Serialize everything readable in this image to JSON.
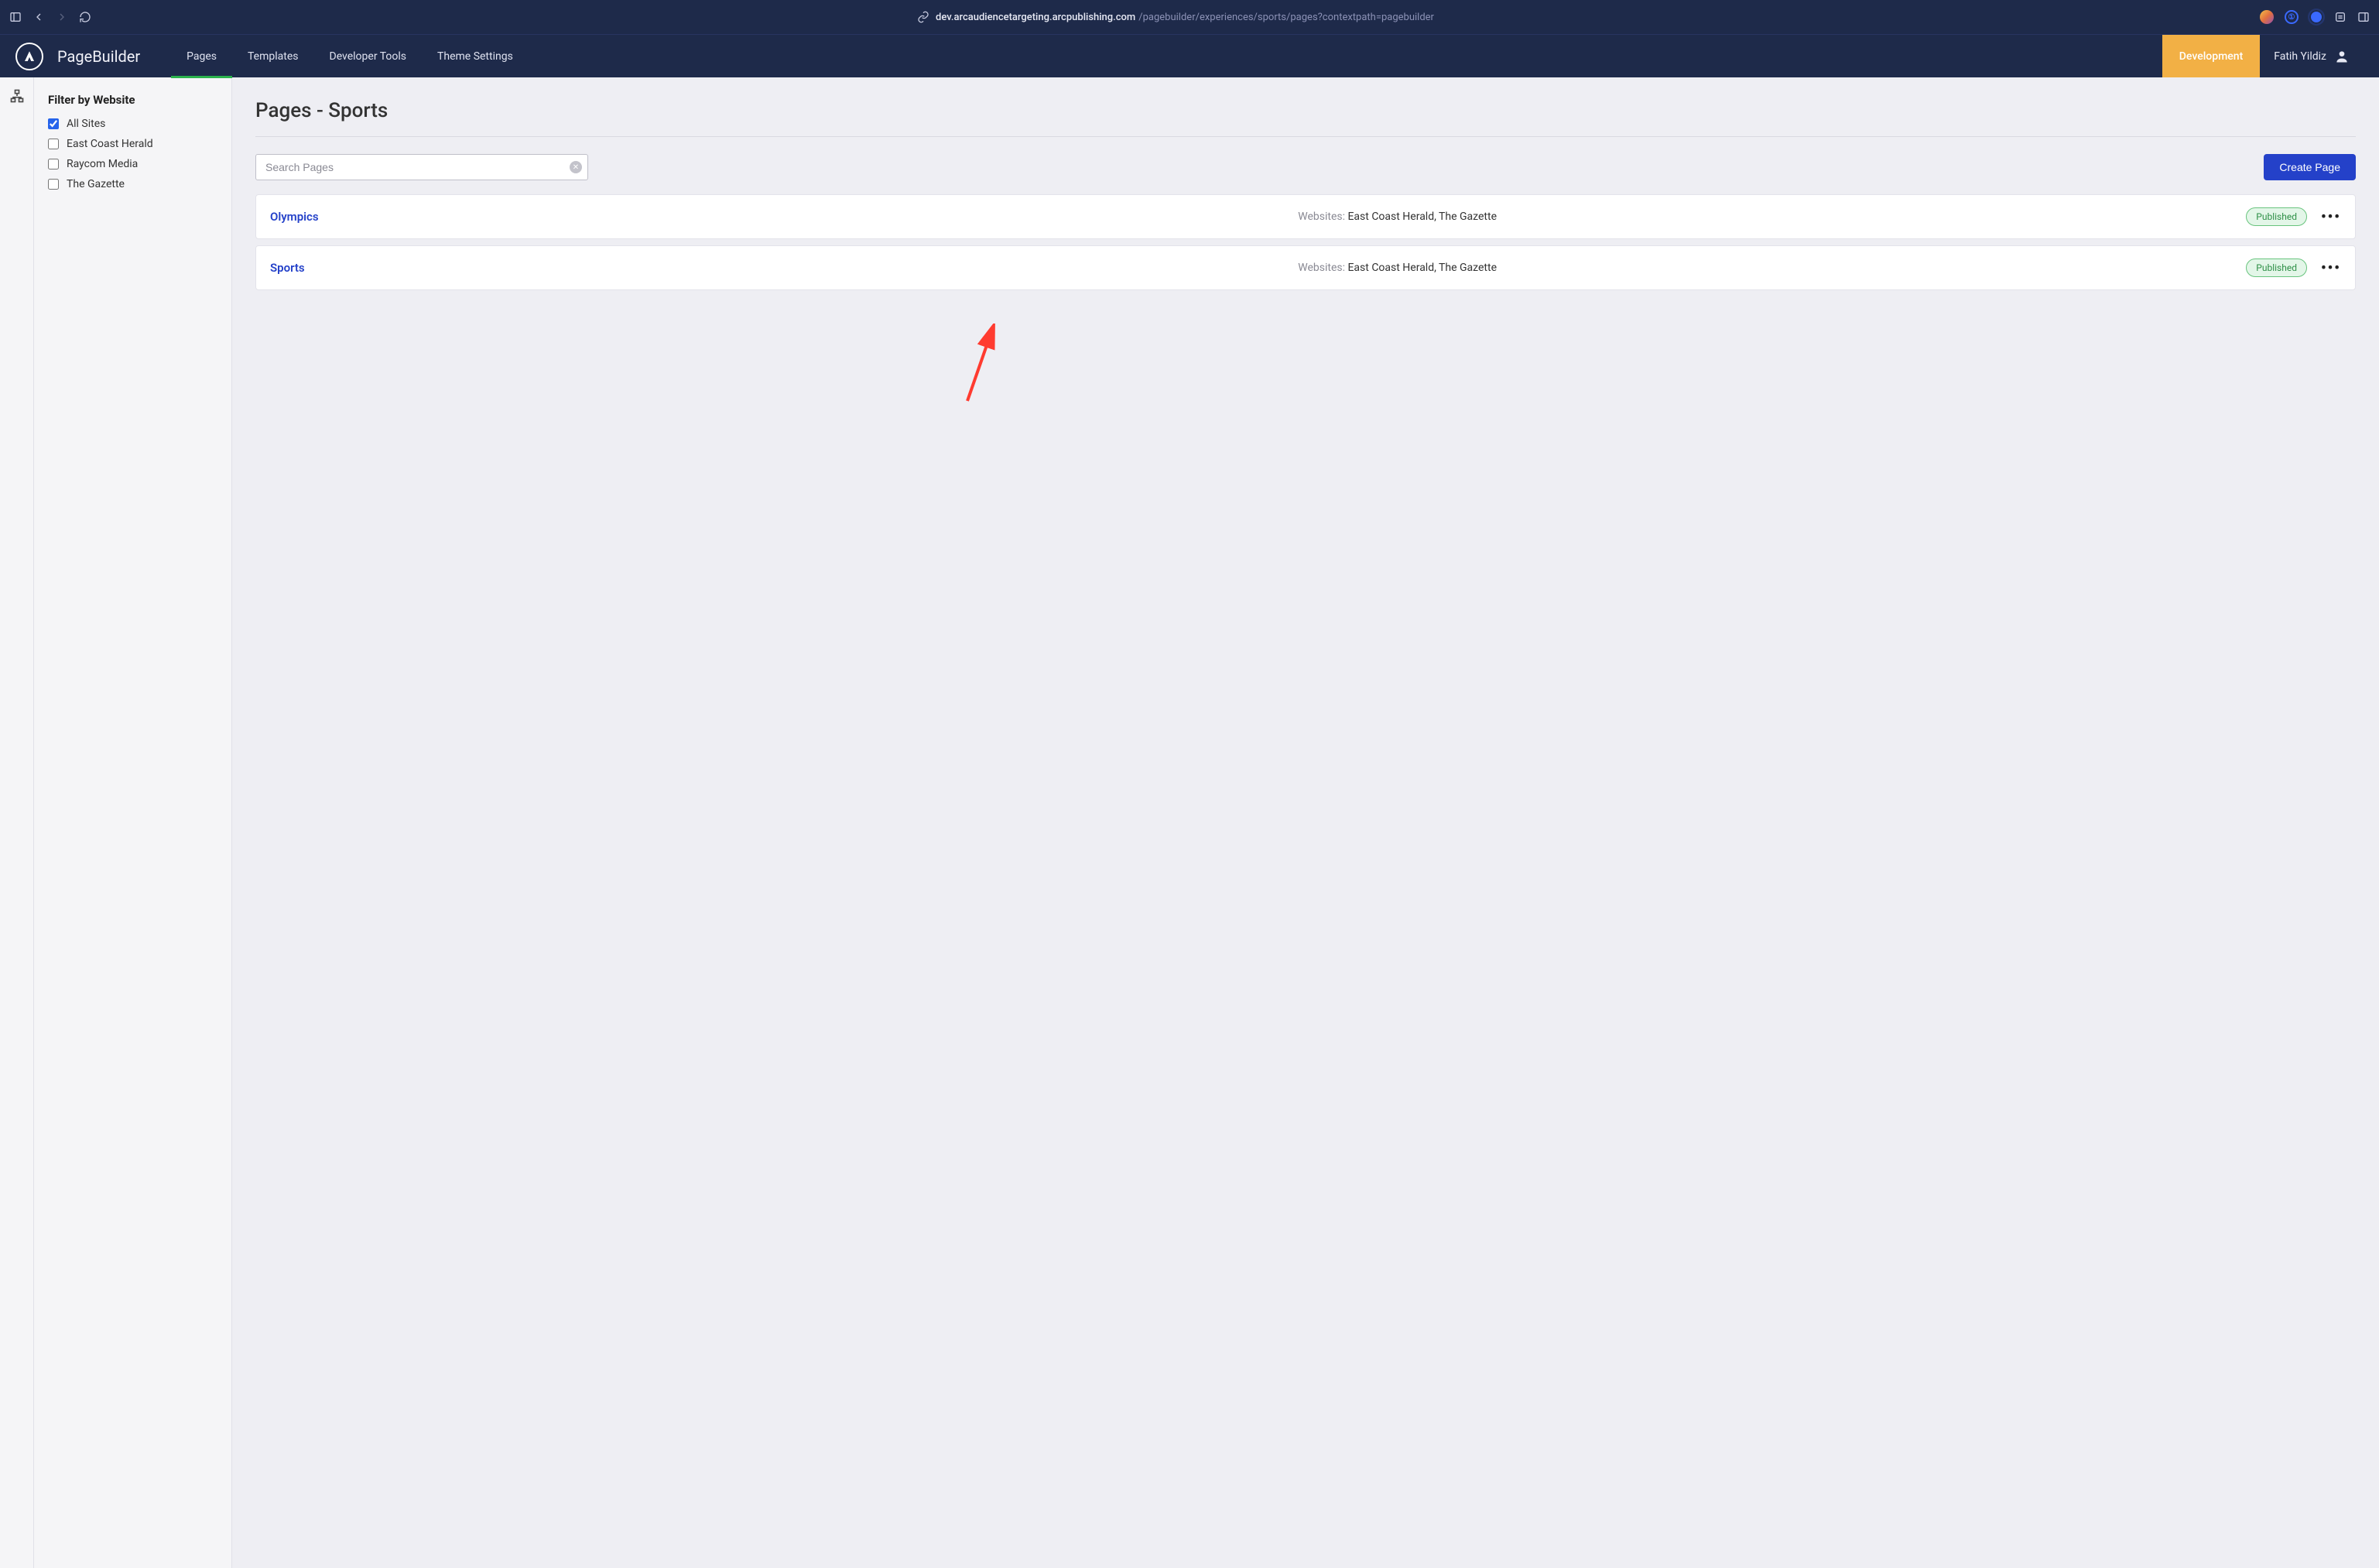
{
  "browser": {
    "url_host": "dev.arcaudiencetargeting.arcpublishing.com",
    "url_path": "/pagebuilder/experiences/sports/pages?contextpath=pagebuilder"
  },
  "header": {
    "brand": "PageBuilder",
    "nav": {
      "pages": "Pages",
      "templates": "Templates",
      "devtools": "Developer Tools",
      "theme": "Theme Settings"
    },
    "env": "Development",
    "user": "Fatih Yildiz"
  },
  "sidebar": {
    "title": "Filter by Website",
    "filters": {
      "all": "All Sites",
      "east": "East Coast Herald",
      "raycom": "Raycom Media",
      "gazette": "The Gazette"
    }
  },
  "content": {
    "title": "Pages - Sports",
    "search_placeholder": "Search Pages",
    "create_label": "Create Page",
    "websites_label": "Websites: ",
    "status_published": "Published",
    "rows": {
      "r0": {
        "title": "Olympics",
        "sites": "East Coast Herald, The Gazette"
      },
      "r1": {
        "title": "Sports",
        "sites": "East Coast Herald, The Gazette"
      }
    }
  }
}
